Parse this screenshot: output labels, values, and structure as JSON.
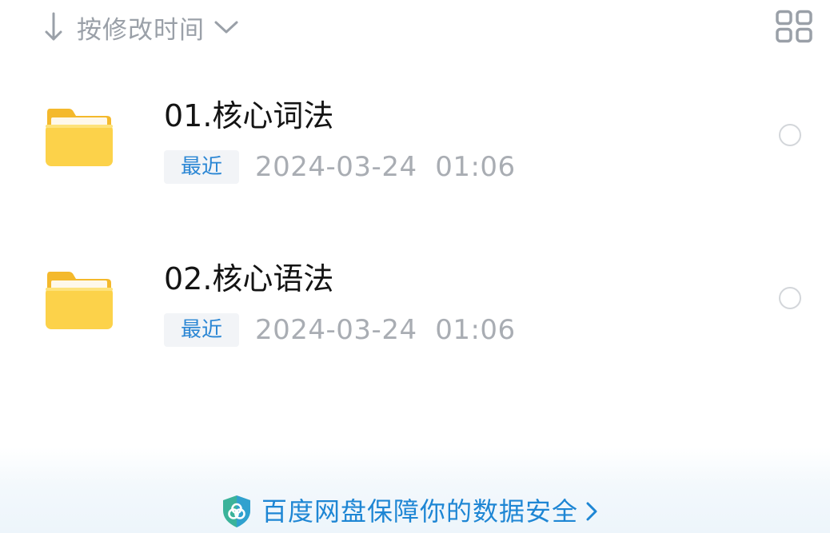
{
  "sort": {
    "label": "按修改时间",
    "arrow_icon": "arrow-down-icon",
    "chevron_icon": "chevron-down-icon"
  },
  "view_toggle": {
    "icon": "grid-view-icon"
  },
  "files": [
    {
      "name": "01.核心词法",
      "badge": "最近",
      "date": "2024-03-24  01:06",
      "icon": "folder-icon",
      "selected": false
    },
    {
      "name": "02.核心语法",
      "badge": "最近",
      "date": "2024-03-24  01:06",
      "icon": "folder-icon",
      "selected": false
    }
  ],
  "footer": {
    "text": "百度网盘保障你的数据安全",
    "icon": "shield-icon",
    "chevron_icon": "chevron-right-icon"
  },
  "colors": {
    "folder": "#fcd24a",
    "accent": "#1e86d4",
    "muted_text": "#a9adb3",
    "badge_bg": "#f2f4f7"
  }
}
